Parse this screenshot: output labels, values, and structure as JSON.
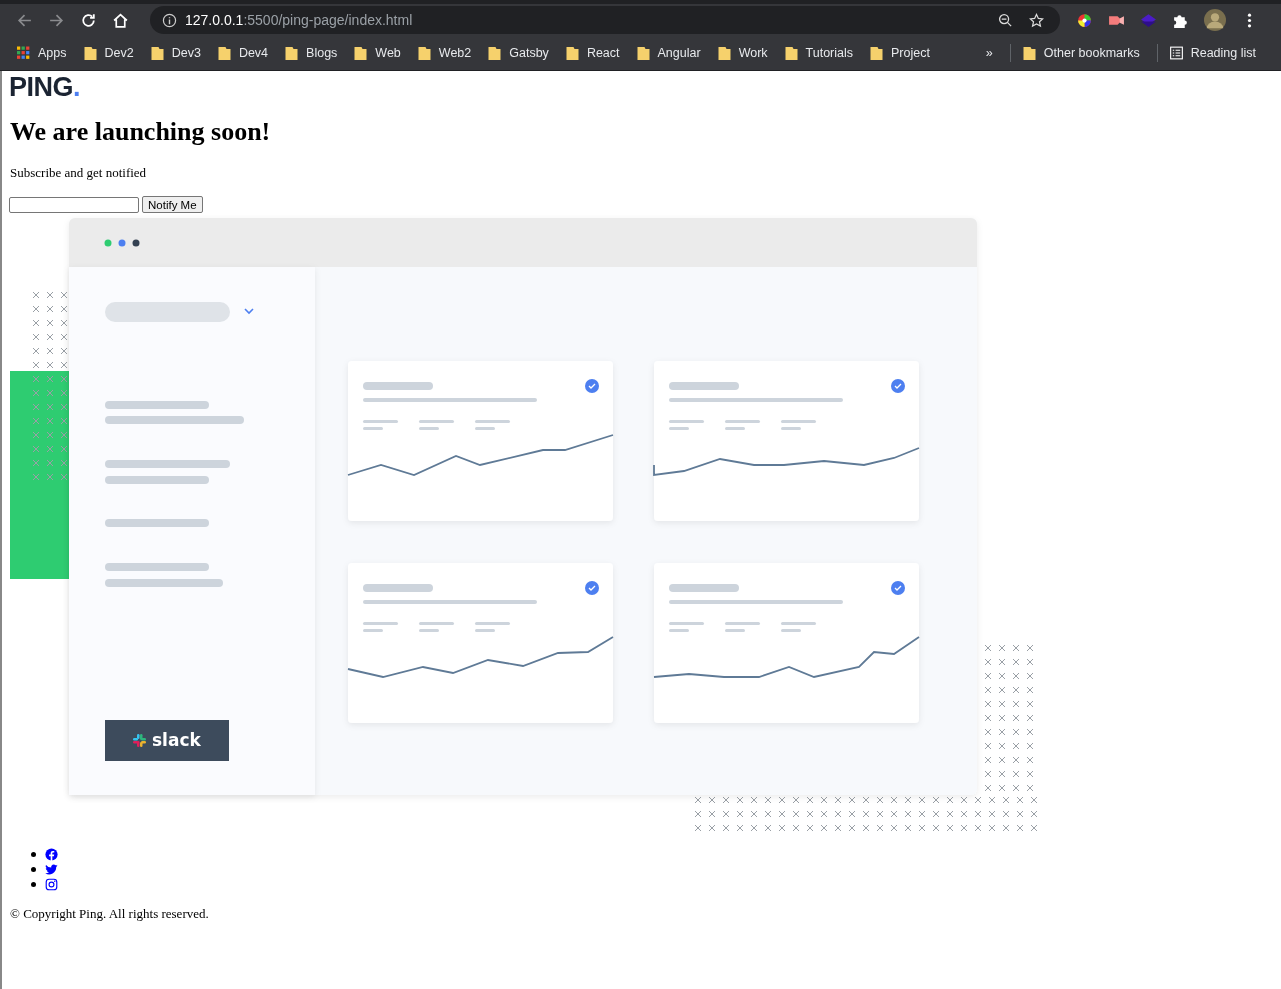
{
  "browser": {
    "url": {
      "host": "127.0.0.1",
      "path": ":5500/ping-page/index.html"
    },
    "bookmarks": [
      {
        "label": "Apps",
        "kind": "apps"
      },
      {
        "label": "Dev2",
        "kind": "folder"
      },
      {
        "label": "Dev3",
        "kind": "folder"
      },
      {
        "label": "Dev4",
        "kind": "folder"
      },
      {
        "label": "Blogs",
        "kind": "folder"
      },
      {
        "label": "Web",
        "kind": "folder"
      },
      {
        "label": "Web2",
        "kind": "folder"
      },
      {
        "label": "Gatsby",
        "kind": "folder"
      },
      {
        "label": "React",
        "kind": "folder"
      },
      {
        "label": "Angular",
        "kind": "folder"
      },
      {
        "label": "Work",
        "kind": "folder"
      },
      {
        "label": "Tutorials",
        "kind": "folder"
      },
      {
        "label": "Project",
        "kind": "folder"
      }
    ],
    "overflow": "»",
    "other_bookmarks": "Other bookmarks",
    "reading_list": "Reading list"
  },
  "page": {
    "logo": {
      "text": "PING",
      "dot": "."
    },
    "heading": "We are launching soon!",
    "subtitle": "Subscribe and get notified",
    "button": "Notify Me",
    "illustration": {
      "badge": "slack"
    },
    "social": [
      {
        "kind": "facebook"
      },
      {
        "kind": "twitter"
      },
      {
        "kind": "instagram"
      }
    ],
    "footer": "© Copyright Ping. All rights reserved."
  }
}
